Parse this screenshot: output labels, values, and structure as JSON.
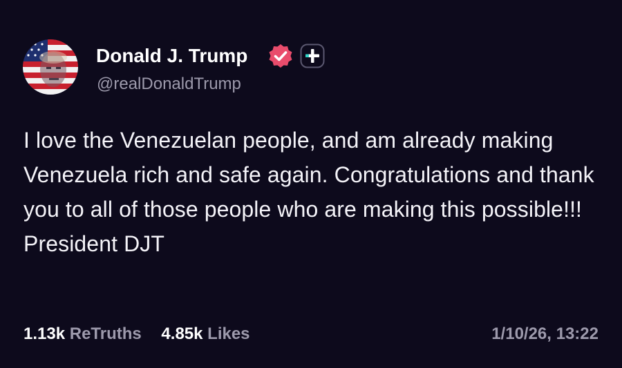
{
  "author": {
    "display_name": "Donald J. Trump",
    "handle": "@realDonaldTrump"
  },
  "post": {
    "text": "I love the Venezuelan people, and am already making Venezuela rich and safe again. Congratulations and thank you to all of those people who are making this possible!!! President DJT"
  },
  "stats": {
    "retruths_count": "1.13k",
    "retruths_label": "ReTruths",
    "likes_count": "4.85k",
    "likes_label": "Likes"
  },
  "timestamp": "1/10/26, 13:22",
  "icons": {
    "avatar": "avatar-flag-portrait",
    "verified": "verified-badge-icon",
    "plus": "plus-badge-icon"
  },
  "colors": {
    "background": "#0d0a1c",
    "text": "#ffffff",
    "muted": "#9d9aac",
    "verified": "#e94c6c",
    "plus_accent": "#2fd3c6"
  }
}
